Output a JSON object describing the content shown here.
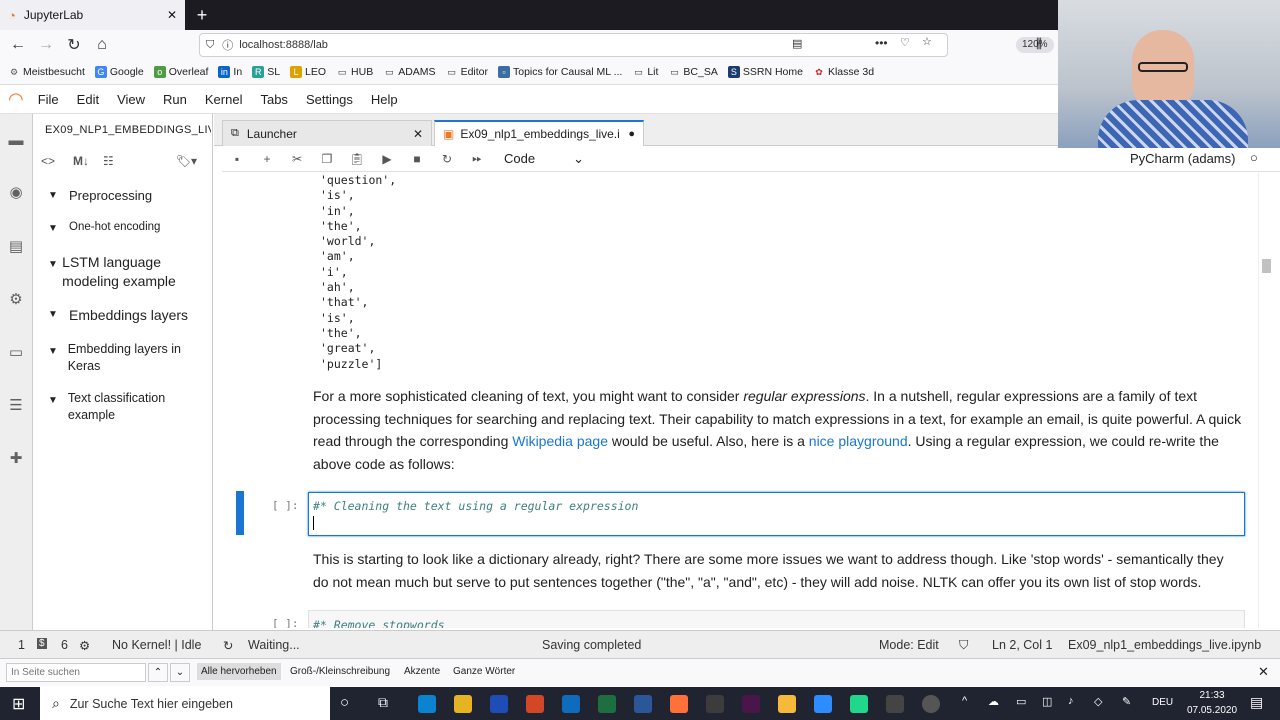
{
  "browser": {
    "tab_title": "JupyterLab",
    "url": "localhost:8888/lab",
    "zoom": "120%",
    "bookmarks": [
      "Meistbesucht",
      "Google",
      "Overleaf",
      "In",
      "SL",
      "LEO",
      "HUB",
      "ADAMS",
      "Editor",
      "Topics for Causal ML ...",
      "Lit",
      "BC_SA",
      "SSRN Home",
      "Klasse 3d"
    ]
  },
  "menu": [
    "File",
    "Edit",
    "View",
    "Run",
    "Kernel",
    "Tabs",
    "Settings",
    "Help"
  ],
  "toc": {
    "title": "EX09_NLP1_EMBEDDINGS_LIVE.I",
    "items": [
      {
        "label": "Preprocessing"
      },
      {
        "label": "One-hot encoding"
      },
      {
        "label": "LSTM language modeling example"
      },
      {
        "label": "Embeddings layers"
      },
      {
        "label": "Embedding layers in Keras"
      },
      {
        "label": "Text classification example"
      }
    ]
  },
  "tabs": {
    "launcher": "Launcher",
    "notebook": "Ex09_nlp1_embeddings_live.i"
  },
  "toolbar": {
    "cell_type": "Code",
    "kernel": "PyCharm (adams)"
  },
  "output_lines": "'question',\n'is',\n'in',\n'the',\n'world',\n'am',\n'i',\n'ah',\n'that',\n'is',\n'the',\n'great',\n'puzzle']",
  "md1": {
    "p1": "For a more sophisticated cleaning of text, you might want to consider ",
    "em": "regular expressions",
    "p2": ". In a nutshell, regular expressions are a family of text processing techniques for searching and replacing text. Their capability to match expressions in a text, for example an email, is quite powerful. A quick read through the corresponding ",
    "link1": "Wikipedia page",
    "p3": " would be useful. Also, here is a ",
    "link2": "nice playground",
    "p4": ". Using a regular expression, we could re-write the above code as follows:"
  },
  "cell": {
    "prompt": "[ ]:",
    "code": "#* Cleaning the text using a regular expression"
  },
  "md2": "This is starting to look like a dictionary already, right? There are some more issues we want to address though. Like 'stop words' - semantically they do not mean much but serve to put sentences together (\"the\", \"a\", \"and\", etc) - they will add noise. NLTK can offer you its own list of stop words.",
  "cell2": {
    "prompt": "[ ]:",
    "code": "#* Remove stopwords"
  },
  "status": {
    "num1": "1",
    "num2": "6",
    "kernel": "No Kernel! | Idle",
    "waiting": "Waiting...",
    "saving": "Saving completed",
    "mode": "Mode: Edit",
    "pos": "Ln 2, Col 1",
    "file": "Ex09_nlp1_embeddings_live.ipynb"
  },
  "findbar": {
    "placeholder": "In Seite suchen",
    "highlight": "Alle hervorheben",
    "case": "Groß-/Kleinschreibung",
    "accents": "Akzente",
    "words": "Ganze Wörter"
  },
  "taskbar": {
    "search": "Zur Suche Text hier eingeben",
    "lang": "DEU",
    "time": "21:33",
    "date": "07.05.2020"
  }
}
